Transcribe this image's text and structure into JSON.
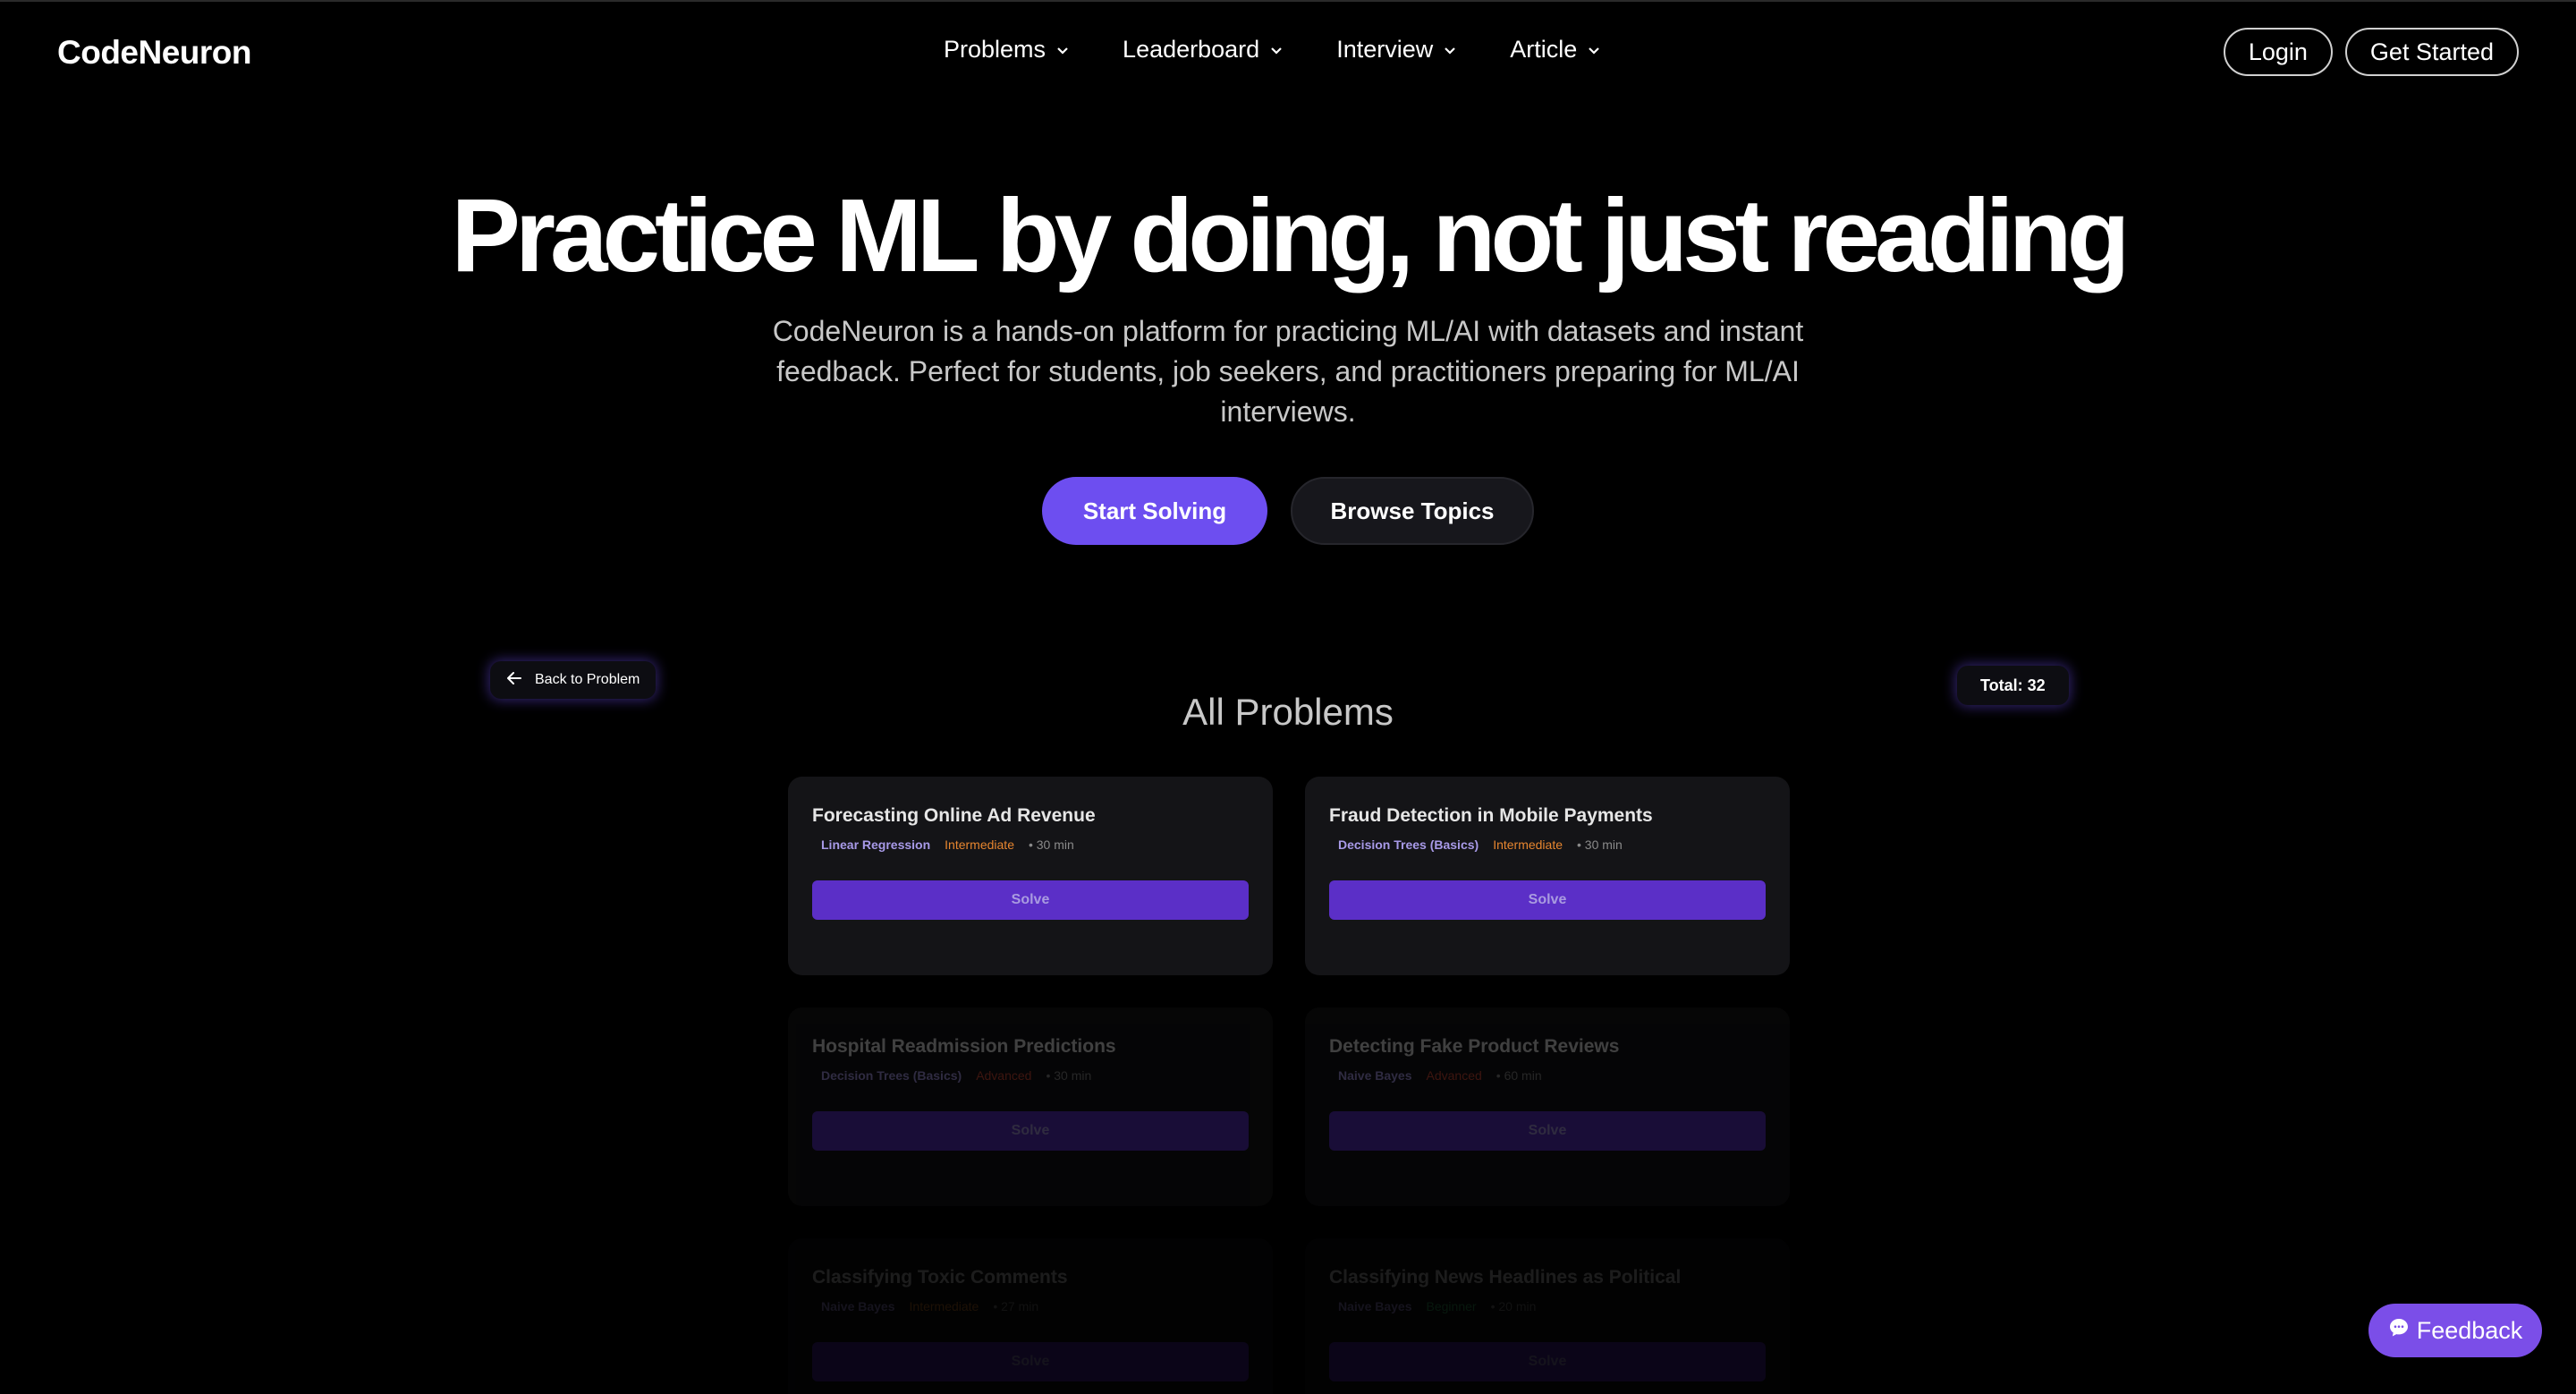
{
  "nav": {
    "logo": "CodeNeuron",
    "items": [
      {
        "label": "Problems"
      },
      {
        "label": "Leaderboard"
      },
      {
        "label": "Interview"
      },
      {
        "label": "Article"
      }
    ],
    "login": "Login",
    "get_started": "Get Started"
  },
  "hero": {
    "title": "Practice ML by doing, not just reading",
    "subtitle": "CodeNeuron is a hands-on platform for practicing ML/AI with datasets and instant feedback. Perfect for students, job seekers, and practitioners preparing for ML/AI interviews.",
    "primary_cta": "Start Solving",
    "secondary_cta": "Browse Topics"
  },
  "problems": {
    "back_label": "Back to Problem",
    "heading": "All Problems",
    "total": "Total: 32",
    "cards": [
      {
        "title": "Forecasting Online Ad Revenue",
        "topic": "Linear Regression",
        "level": "Intermediate",
        "time": "• 30 min",
        "action": "Solve"
      },
      {
        "title": "Fraud Detection in Mobile Payments",
        "topic": "Decision Trees (Basics)",
        "level": "Intermediate",
        "time": "• 30 min",
        "action": "Solve"
      },
      {
        "title": "Hospital Readmission Predictions",
        "topic": "Decision Trees (Basics)",
        "level": "Advanced",
        "time": "• 30 min",
        "action": "Solve"
      },
      {
        "title": "Detecting Fake Product Reviews",
        "topic": "Naive Bayes",
        "level": "Advanced",
        "time": "• 60 min",
        "action": "Solve"
      },
      {
        "title": "Classifying Toxic Comments",
        "topic": "Naive Bayes",
        "level": "Intermediate",
        "time": "• 27 min",
        "action": "Solve"
      },
      {
        "title": "Classifying News Headlines as Political",
        "topic": "Naive Bayes",
        "level": "Beginner",
        "time": "• 20 min",
        "action": "Solve"
      }
    ]
  },
  "feedback": "Feedback",
  "colors": {
    "accent": "#6d4ef0",
    "solve_button": "#5b2fc7",
    "intermediate": "#e7862f",
    "advanced": "#d84b37",
    "beginner": "#3bbd6a",
    "feedback": "#7b4ee8"
  },
  "icons": {
    "nav_chevron": "chevron-down-icon",
    "back": "arrow-left-icon",
    "feedback": "chat-bubble-icon"
  }
}
